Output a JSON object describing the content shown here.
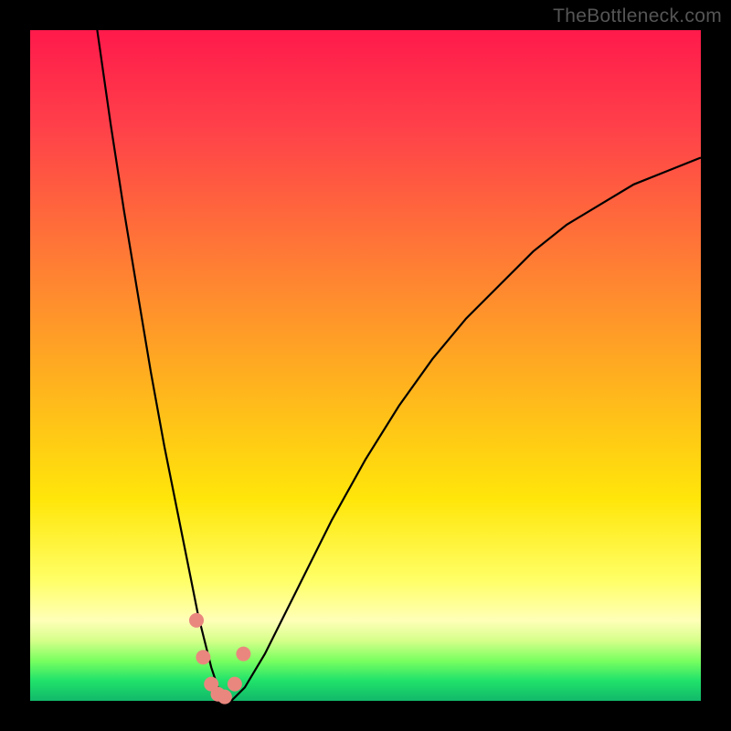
{
  "watermark": "TheBottleneck.com",
  "chart_data": {
    "type": "line",
    "title": "",
    "xlabel": "",
    "ylabel": "",
    "xlim": [
      0,
      100
    ],
    "ylim": [
      0,
      100
    ],
    "series": [
      {
        "name": "curve",
        "x": [
          10,
          12,
          14,
          16,
          18,
          20,
          22,
          24,
          25,
          26,
          27,
          28,
          29,
          30,
          32,
          35,
          40,
          45,
          50,
          55,
          60,
          65,
          70,
          75,
          80,
          85,
          90,
          95,
          100
        ],
        "y": [
          100,
          86,
          73,
          61,
          49,
          38,
          28,
          18,
          13,
          9,
          5,
          2,
          1,
          0,
          2,
          7,
          17,
          27,
          36,
          44,
          51,
          57,
          62,
          67,
          71,
          74,
          77,
          79,
          81
        ]
      }
    ],
    "markers": {
      "color": "#e9877e",
      "points_x": [
        24.8,
        25.8,
        27.0,
        28.0,
        29.0,
        30.5,
        31.8
      ],
      "points_y": [
        12,
        6.5,
        2.5,
        1,
        0.6,
        2.5,
        7
      ]
    }
  }
}
